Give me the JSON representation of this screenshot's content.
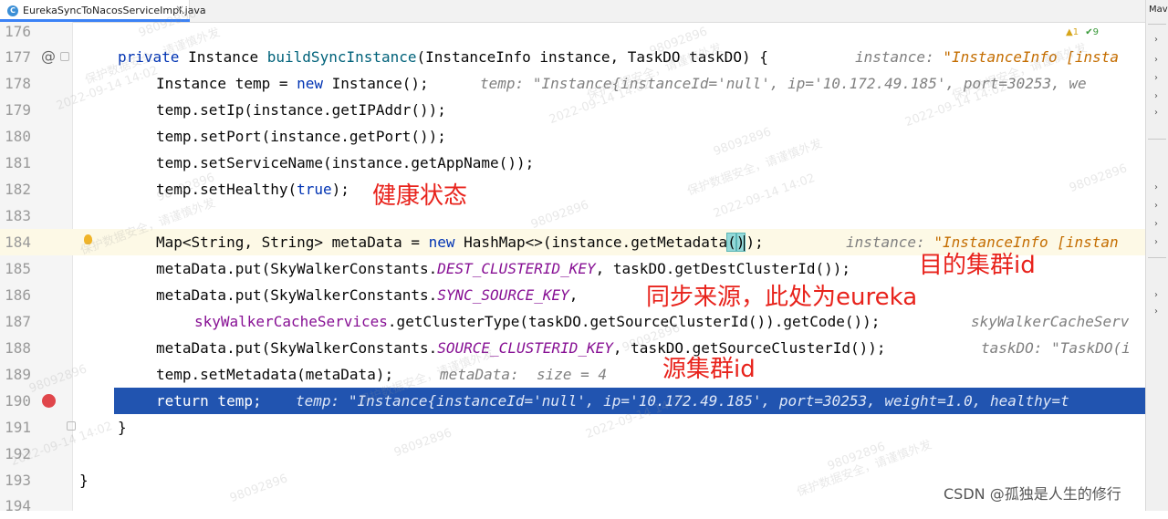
{
  "tab": {
    "filename": "EurekaSyncToNacosServiceImpl.java",
    "close": "×"
  },
  "right_panel": {
    "title": "Mav"
  },
  "inspections": {
    "warnings": "▲1",
    "checks": "✔9"
  },
  "annotations": {
    "healthy": "健康状态",
    "dest_id": "目的集群id",
    "sync_source": "同步来源，此处为eureka",
    "src_id": "源集群id"
  },
  "watermark": {
    "id": "98092896",
    "notice": "保护数据安全，请谨慎外发",
    "date": "2022-09-14 14:02"
  },
  "footer": {
    "credit": "CSDN @孤独是人生的修行"
  },
  "lines": [
    {
      "n": "176"
    },
    {
      "n": "177"
    },
    {
      "n": "178"
    },
    {
      "n": "179"
    },
    {
      "n": "180"
    },
    {
      "n": "181"
    },
    {
      "n": "182"
    },
    {
      "n": "183"
    },
    {
      "n": "184"
    },
    {
      "n": "185"
    },
    {
      "n": "186"
    },
    {
      "n": "187"
    },
    {
      "n": "188"
    },
    {
      "n": "189"
    },
    {
      "n": "190"
    },
    {
      "n": "191"
    },
    {
      "n": "192"
    },
    {
      "n": "193"
    },
    {
      "n": "194"
    }
  ],
  "code": {
    "l177": {
      "kw": "private",
      "type": " Instance ",
      "fn": "buildSyncInstance",
      "rest": "(InstanceInfo instance, TaskDO taskDO) {",
      "hint_k": "instance:",
      "hint_v": "\"InstanceInfo [insta"
    },
    "l178": {
      "a": "Instance temp = ",
      "kw": "new",
      "b": " Instance();",
      "hint_k": "temp:",
      "hint_v": "\"Instance{instanceId='null', ip='10.172.49.185', port=30253, we"
    },
    "l179": "temp.setIp(instance.getIPAddr());",
    "l180": "temp.setPort(instance.getPort());",
    "l181": "temp.setServiceName(instance.getAppName());",
    "l182": {
      "a": "temp.setHealthy(",
      "kw": "true",
      "b": ");"
    },
    "l184": {
      "a": "Map<String, String> metaData = ",
      "kw": "new",
      "b": " HashMap<>(instance.getMetadata",
      "br1": "(",
      "br2": ")",
      "c": ");",
      "hint_k": "instance:",
      "hint_v": "\"InstanceInfo [instan"
    },
    "l185": {
      "a": "metaData.put(SkyWalkerConstants.",
      "cst": "DEST_CLUSTERID_KEY",
      "b": ", taskDO.getDestClusterId());"
    },
    "l186": {
      "a": "metaData.put(SkyWalkerConstants.",
      "cst": "SYNC_SOURCE_KEY",
      "b": ","
    },
    "l187": {
      "fld": "skyWalkerCacheServices",
      "b": ".getClusterType(taskDO.getSourceClusterId()).getCode());",
      "hint_k": "skyWalkerCacheServ"
    },
    "l188": {
      "a": "metaData.put(SkyWalkerConstants.",
      "cst": "SOURCE_CLUSTERID_KEY",
      "b": ", taskDO.getSourceClusterId());",
      "hint_k": "taskDO:",
      "hint_v": "\"TaskDO(i"
    },
    "l189": {
      "a": "temp.setMetadata(metaData);",
      "hint_k": "metaData:",
      "hint_v": "size = 4"
    },
    "l190": {
      "kw": "return",
      "b": " temp;",
      "hint_k": "temp:",
      "hint_v": "\"Instance{instanceId='null', ip='10.172.49.185', port=30253, weight=1.0, healthy=t"
    },
    "l191": "}",
    "l193": "}"
  },
  "colors": {
    "accent": "#2154b0",
    "annotation": "#e8231c",
    "highlight_row": "#fdf9e6",
    "keyword": "#0033b3"
  },
  "icons": [
    "java-file-icon",
    "at-sign-icon",
    "bulb-icon",
    "breakpoint-icon",
    "fold-icon"
  ]
}
